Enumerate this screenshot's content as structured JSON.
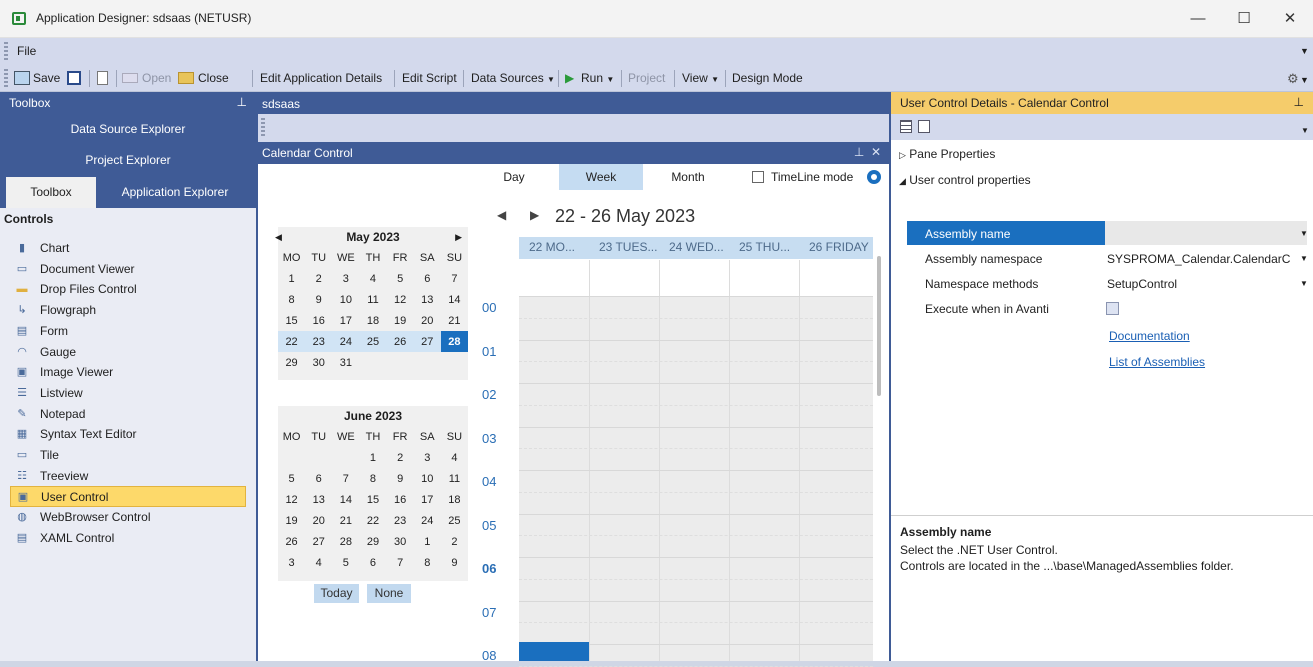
{
  "window": {
    "title": "Application Designer: sdsaas  (NETUSR)",
    "minimize": "—",
    "maximize": "☐",
    "close": "✕"
  },
  "menu": {
    "file": "File"
  },
  "toolbar": {
    "save": "Save",
    "open": "Open",
    "close": "Close",
    "edit_app": "Edit Application Details",
    "edit_script": "Edit Script",
    "data_sources": "Data Sources",
    "run": "Run",
    "project": "Project",
    "view": "View",
    "design_mode": "Design Mode"
  },
  "toolbox": {
    "header": "Toolbox",
    "nav": [
      "Data Source Explorer",
      "Project Explorer"
    ],
    "tabs": {
      "toolbox": "Toolbox",
      "app_explorer": "Application Explorer"
    },
    "section": "Controls",
    "items": [
      {
        "label": "Chart",
        "icon": "chart-icon"
      },
      {
        "label": "Document Viewer",
        "icon": "document-viewer-icon"
      },
      {
        "label": "Drop Files Control",
        "icon": "folder-icon"
      },
      {
        "label": "Flowgraph",
        "icon": "flowgraph-icon"
      },
      {
        "label": "Form",
        "icon": "form-icon"
      },
      {
        "label": "Gauge",
        "icon": "gauge-icon"
      },
      {
        "label": "Image Viewer",
        "icon": "image-icon"
      },
      {
        "label": "Listview",
        "icon": "listview-icon"
      },
      {
        "label": "Notepad",
        "icon": "notepad-icon"
      },
      {
        "label": "Syntax Text Editor",
        "icon": "text-editor-icon"
      },
      {
        "label": "Tile",
        "icon": "tile-icon"
      },
      {
        "label": "Treeview",
        "icon": "treeview-icon"
      },
      {
        "label": "User Control",
        "icon": "user-control-icon",
        "selected": true
      },
      {
        "label": "WebBrowser Control",
        "icon": "globe-icon"
      },
      {
        "label": "XAML Control",
        "icon": "xaml-icon"
      }
    ]
  },
  "document": {
    "tab": "sdsaas",
    "calendar_header": "Calendar Control",
    "pin": "⊥",
    "close": "✕"
  },
  "calendar": {
    "weekdays": [
      "MO",
      "TU",
      "WE",
      "TH",
      "FR",
      "SA",
      "SU"
    ],
    "may": {
      "title": "May 2023",
      "rows": [
        [
          "1",
          "2",
          "3",
          "4",
          "5",
          "6",
          "7"
        ],
        [
          "8",
          "9",
          "10",
          "11",
          "12",
          "13",
          "14"
        ],
        [
          "15",
          "16",
          "17",
          "18",
          "19",
          "20",
          "21"
        ],
        [
          "22",
          "23",
          "24",
          "25",
          "26",
          "27",
          "28"
        ],
        [
          "29",
          "30",
          "31",
          "",
          "",
          "",
          ""
        ]
      ]
    },
    "june": {
      "title": "June 2023",
      "rows": [
        [
          "",
          "",
          "",
          "1",
          "2",
          "3",
          "4"
        ],
        [
          "5",
          "6",
          "7",
          "8",
          "9",
          "10",
          "11"
        ],
        [
          "12",
          "13",
          "14",
          "15",
          "16",
          "17",
          "18"
        ],
        [
          "19",
          "20",
          "21",
          "22",
          "23",
          "24",
          "25"
        ],
        [
          "26",
          "27",
          "28",
          "29",
          "30",
          "1",
          "2"
        ],
        [
          "3",
          "4",
          "5",
          "6",
          "7",
          "8",
          "9"
        ]
      ]
    },
    "today_btn": "Today",
    "none_btn": "None",
    "views": {
      "day": "Day",
      "week": "Week",
      "month": "Month",
      "timeline": "TimeLine mode"
    },
    "range": "22 - 26 May 2023",
    "days": [
      "22 MO...",
      "23 TUES...",
      "24 WED...",
      "25 THU...",
      "26 FRIDAY"
    ],
    "hours": [
      "00",
      "01",
      "02",
      "03",
      "04",
      "05",
      "06",
      "07",
      "08"
    ]
  },
  "details": {
    "header": "User Control Details - Calendar Control",
    "pane_properties": "Pane Properties",
    "user_control_properties": "User control properties",
    "props": [
      {
        "label": "Assembly name",
        "value": ""
      },
      {
        "label": "Assembly namespace",
        "value": "SYSPROMA_Calendar.CalendarC"
      },
      {
        "label": "Namespace methods",
        "value": "SetupControl"
      },
      {
        "label": "Execute when in Avanti",
        "value": ""
      }
    ],
    "links": [
      "Documentation",
      "List of Assemblies"
    ],
    "desc_title": "Assembly name",
    "desc_line1": "Select the .NET User Control.",
    "desc_line2": "Controls are located in the ...\\base\\ManagedAssemblies folder."
  }
}
